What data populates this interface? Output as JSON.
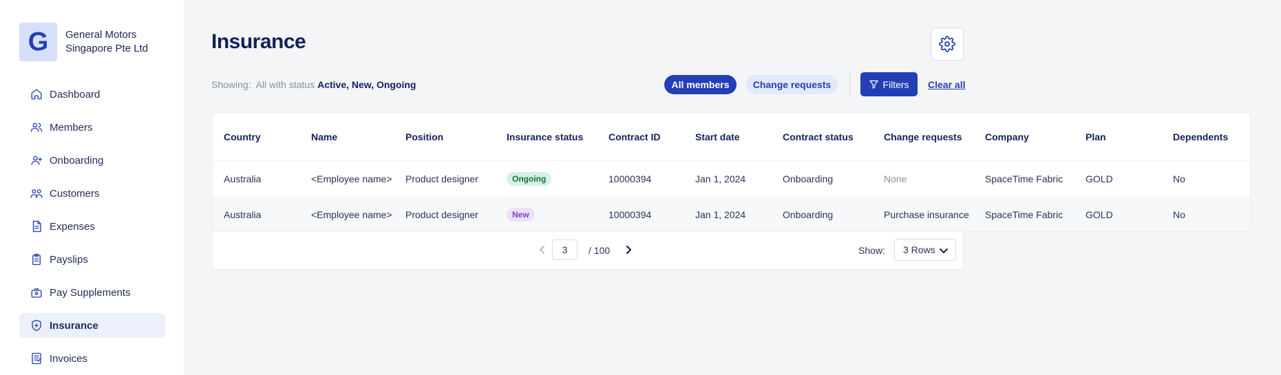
{
  "company": {
    "logo_letter": "G",
    "name": "General Motors Singapore Pte Ltd"
  },
  "nav": [
    {
      "label": "Dashboard",
      "icon": "home-icon",
      "active": false
    },
    {
      "label": "Members",
      "icon": "users-icon",
      "active": false
    },
    {
      "label": "Onboarding",
      "icon": "user-plus-icon",
      "active": false
    },
    {
      "label": "Customers",
      "icon": "customers-icon",
      "active": false
    },
    {
      "label": "Expenses",
      "icon": "receipt-icon",
      "active": false
    },
    {
      "label": "Payslips",
      "icon": "clipboard-icon",
      "active": false
    },
    {
      "label": "Pay Supplements",
      "icon": "briefcase-icon",
      "active": false
    },
    {
      "label": "Insurance",
      "icon": "shield-icon",
      "active": true
    },
    {
      "label": "Invoices",
      "icon": "invoice-icon",
      "active": false
    }
  ],
  "page": {
    "title": "Insurance"
  },
  "filter_bar": {
    "showing_label": "Showing:",
    "showing_prefix": "All with status",
    "statuses": "Active, New, Ongoing",
    "all_members": "All members",
    "change_requests": "Change requests",
    "filters": "Filters",
    "clear_all": "Clear all"
  },
  "table": {
    "headers": [
      "Country",
      "Name",
      "Position",
      "Insurance status",
      "Contract ID",
      "Start date",
      "Contract status",
      "Change requests",
      "Company",
      "Plan",
      "Dependents"
    ],
    "rows": [
      [
        "Australia",
        "<Employee name>",
        "Product designer",
        "Ongoing",
        "10000394",
        "Jan 1, 2024",
        "Onboarding",
        "None",
        "SpaceTime Fabric",
        "GOLD",
        "No"
      ],
      [
        "Australia",
        "<Employee name>",
        "Product designer",
        "New",
        "10000394",
        "Jan 1, 2024",
        "Onboarding",
        "Purchase insurance",
        "SpaceTime Fabric",
        "GOLD",
        "No"
      ]
    ]
  },
  "colors": {
    "primary": "#233fb5",
    "ongoing_bg": "#d4f1e4",
    "ongoing_fg": "#1b6b47",
    "new_bg": "#ece0fb",
    "new_fg": "#7b45c9"
  },
  "pagination": {
    "current_page": "3",
    "total": "/ 100",
    "show_label": "Show:",
    "rows_option": "3 Rows"
  }
}
